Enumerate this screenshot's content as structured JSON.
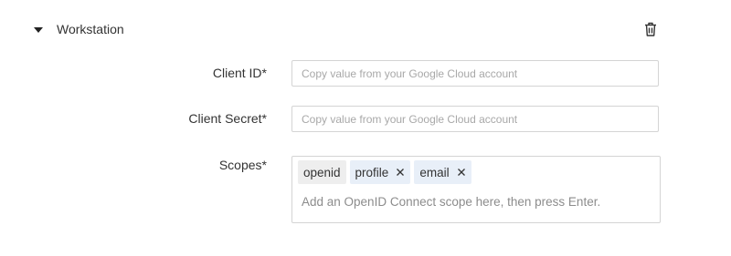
{
  "section": {
    "title": "Workstation",
    "toggle_icon": "caret-down-icon",
    "delete_icon": "trash-icon"
  },
  "fields": {
    "client_id": {
      "label": "Client ID*",
      "value": "",
      "placeholder": "Copy value from your Google Cloud account"
    },
    "client_secret": {
      "label": "Client Secret*",
      "value": "",
      "placeholder": "Copy value from your Google Cloud account"
    },
    "scopes": {
      "label": "Scopes*",
      "chips": [
        {
          "label": "openid",
          "removable": false
        },
        {
          "label": "profile",
          "removable": true
        },
        {
          "label": "email",
          "removable": true
        }
      ],
      "value": "",
      "placeholder": "Add an OpenID Connect scope here, then press Enter."
    }
  },
  "colors": {
    "chip_removable_bg": "#e8eff8",
    "chip_fixed_bg": "#eeeeee",
    "border": "#d4d4d4"
  }
}
